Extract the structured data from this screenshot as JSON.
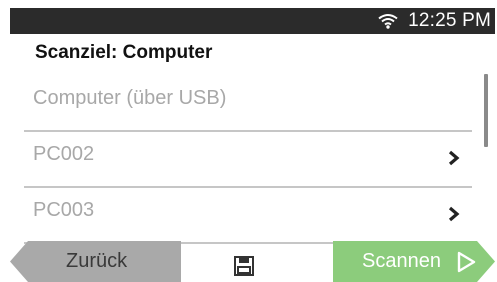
{
  "status_bar": {
    "time": "12:25 PM",
    "wifi_icon": "wifi-icon"
  },
  "title": "Scanziel: Computer",
  "list": {
    "items": [
      {
        "label": "Computer (über USB)",
        "has_chevron": false
      },
      {
        "label": "PC002",
        "has_chevron": true
      },
      {
        "label": "PC003",
        "has_chevron": true
      }
    ]
  },
  "footer": {
    "back_label": "Zurück",
    "save_icon": "save-icon",
    "scan_label": "Scannen"
  },
  "colors": {
    "status_bar_bg": "#2b2b2b",
    "back_button": "#a9a9a9",
    "scan_button": "#8ccc7c",
    "divider": "#c6c6c6",
    "item_text": "#a8a8a8"
  }
}
